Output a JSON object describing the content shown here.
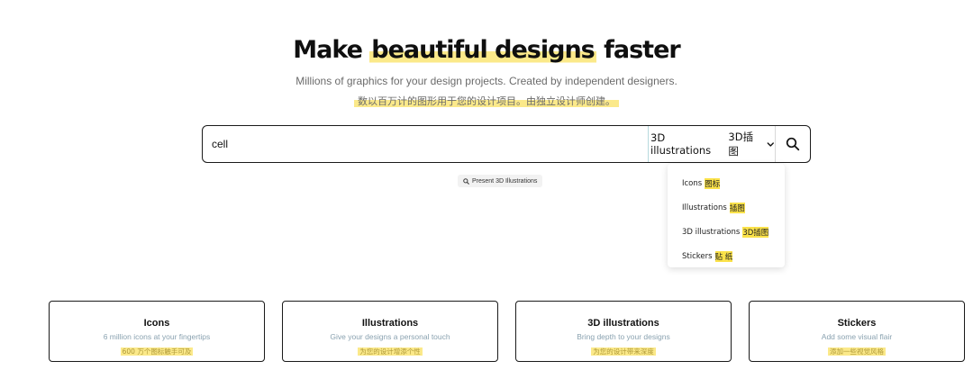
{
  "hero": {
    "title_part1": "Make ",
    "title_highlight": "beautiful designs",
    "title_part2": " faster",
    "subtitle": "Millions of graphics for your design projects. Created by independent designers.",
    "subtitle_cn": "数以百万计的图形用于您的设计项目。由独立设计师创建。"
  },
  "search": {
    "value": "cell",
    "type_en": "3D illustrations",
    "type_cn": "3D插图",
    "icon": "search-icon"
  },
  "chip": {
    "label": "Present 3D Illustrations",
    "icon": "search-icon"
  },
  "dropdown": {
    "items": [
      {
        "en": "Icons",
        "cn": "图标"
      },
      {
        "en": "Illustrations",
        "cn": "插图"
      },
      {
        "en": "3D illustrations",
        "cn": "3D插图"
      },
      {
        "en": "Stickers",
        "cn": "贴 纸"
      }
    ]
  },
  "cards": [
    {
      "title": "Icons",
      "desc": "6 million icons at your fingertips",
      "cn": "600 万个图标触手可及"
    },
    {
      "title": "Illustrations",
      "desc": "Give your designs a personal touch",
      "cn": "为您的设计增添个性"
    },
    {
      "title": "3D illustrations",
      "desc": "Bring depth to your designs",
      "cn": "为您的设计带来深度"
    },
    {
      "title": "Stickers",
      "desc": "Add some visual flair",
      "cn": "添加一些视觉风格"
    }
  ],
  "colors": {
    "highlight": "#fbe98a",
    "highlight_strong": "#fbe24a",
    "border": "#1a1a1a",
    "muted_text": "#6b6b6b",
    "card_desc": "#8aa2b0"
  }
}
